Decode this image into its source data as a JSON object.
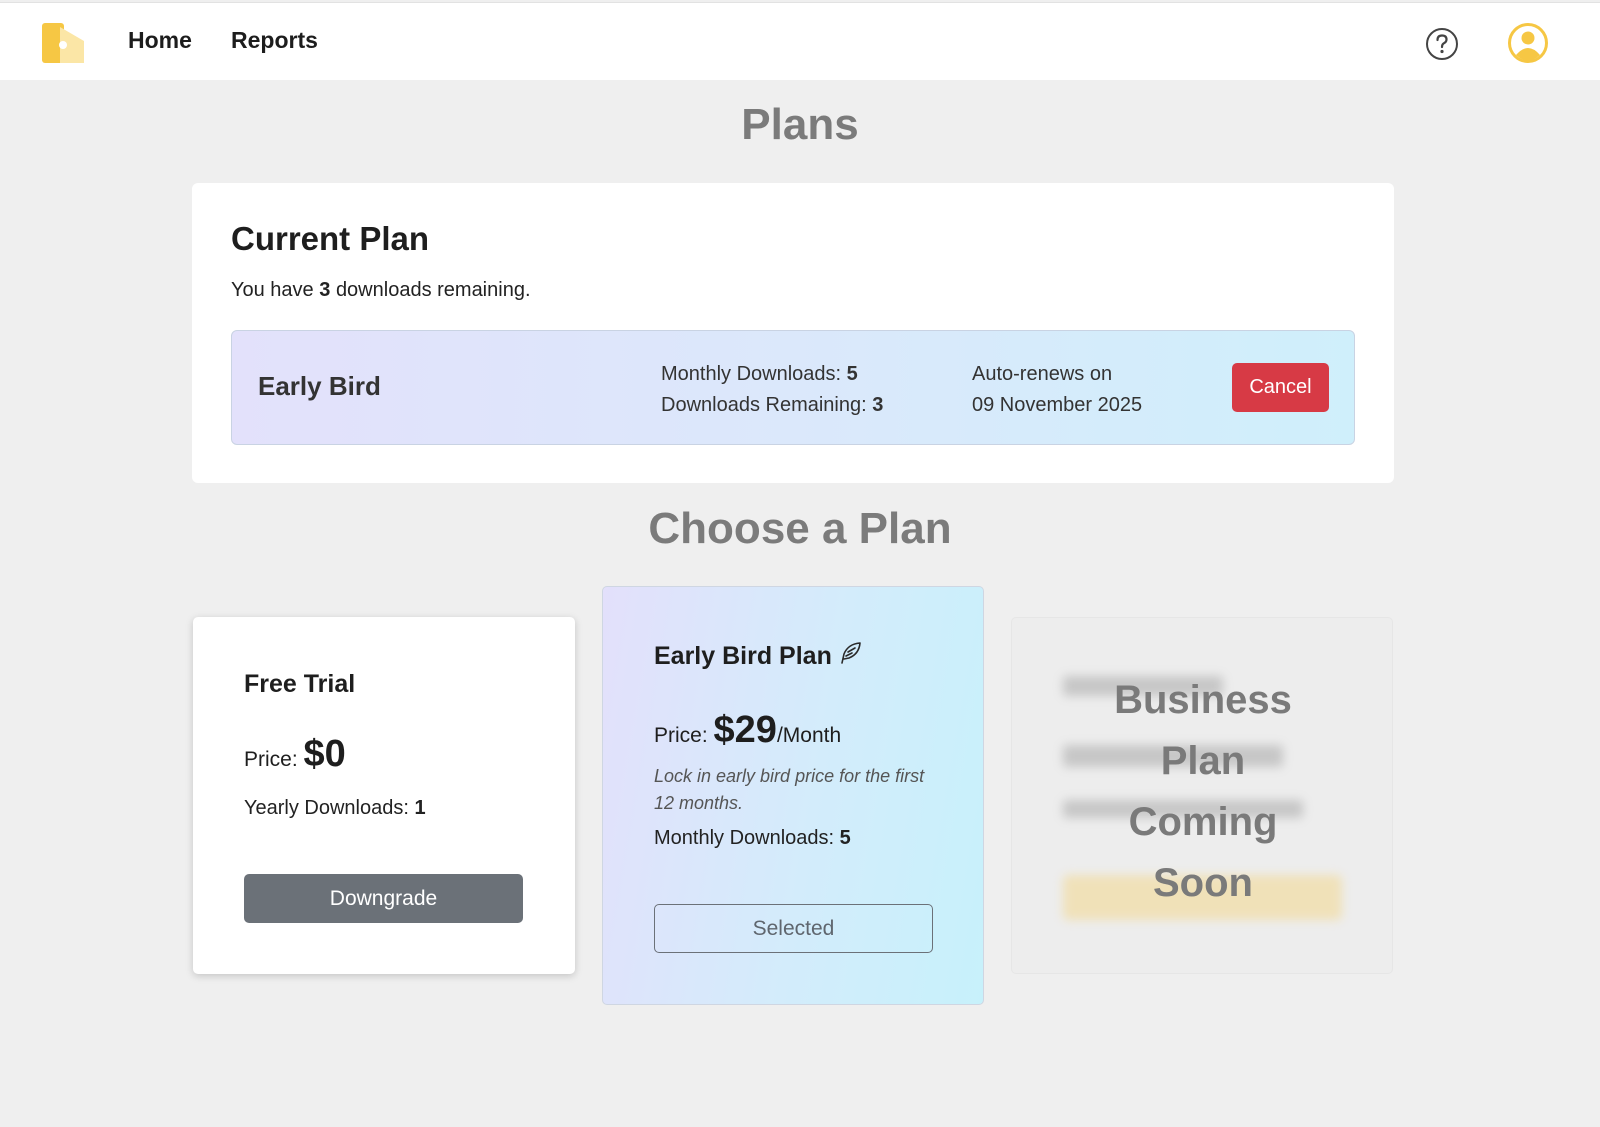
{
  "nav": {
    "home": "Home",
    "reports": "Reports",
    "icons": {
      "logo": "logo-icon",
      "help": "help-icon",
      "user": "user-avatar-icon"
    }
  },
  "page_title": "Plans",
  "current_plan": {
    "heading": "Current Plan",
    "remaining_prefix": "You have",
    "remaining_count": "3",
    "remaining_suffix": "downloads remaining.",
    "plan_name": "Early Bird",
    "monthly_downloads_label": "Monthly Downloads:",
    "monthly_downloads_value": "5",
    "downloads_remaining_label": "Downloads Remaining:",
    "downloads_remaining_value": "3",
    "renew_label": "Auto-renews on",
    "renew_date": "09 November 2025",
    "cancel_label": "Cancel"
  },
  "choose_title": "Choose a Plan",
  "plans": {
    "free": {
      "title": "Free Trial",
      "price_label": "Price:",
      "price": "$0",
      "downloads_label": "Yearly Downloads:",
      "downloads_value": "1",
      "button": "Downgrade"
    },
    "early": {
      "title": "Early Bird Plan",
      "price_label": "Price:",
      "price": "$29",
      "price_unit": "/Month",
      "note": "Lock in early bird price for the first 12 months.",
      "downloads_label": "Monthly Downloads:",
      "downloads_value": "5",
      "button": "Selected"
    },
    "business": {
      "overlay": [
        "Business",
        "Plan",
        "Coming",
        "Soon"
      ]
    }
  },
  "colors": {
    "accent_yellow": "#f6c744",
    "cancel_red": "#d73a45",
    "button_gray": "#6b7178",
    "page_bg": "#efefef"
  }
}
